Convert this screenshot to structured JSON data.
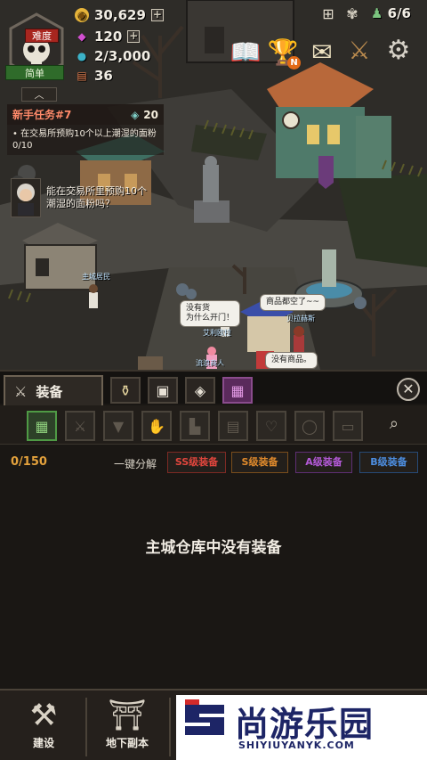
{
  "hud": {
    "difficulty_tag": "难度",
    "difficulty_level": "简单",
    "gold": "30,629",
    "gems": "120",
    "potion": "2/3,000",
    "cards": "36",
    "population": "6/6",
    "notify_badge": "N",
    "icons": [
      "gold-coin-icon",
      "gem-icon",
      "potion-icon",
      "card-icon",
      "gift-icon",
      "settings-icon"
    ]
  },
  "quest": {
    "title": "新手任务#7",
    "reward": "20",
    "line1": "在交易所预购10个以上潮湿的面粉",
    "progress": "0/10",
    "dialogue": "能在交易所里预购10个潮湿的面粉吗？"
  },
  "world_labels": {
    "bubble_left": "没有货\n为什么开门！",
    "bubble_mid": "商品都空了~~",
    "bubble_right": "没有商品。",
    "name_1": "主城居民",
    "name_2": "艾利欧拉",
    "name_3": "贝拉赫斯",
    "name_4": "流浪商人"
  },
  "panel": {
    "tab_label": "装备",
    "count": "0/150",
    "onekey_label": "一键分解",
    "grades": [
      {
        "label": "SS级装备",
        "color": "#e0463d"
      },
      {
        "label": "S级装备",
        "color": "#e08a2c"
      },
      {
        "label": "A级装备",
        "color": "#b45ad8"
      },
      {
        "label": "B级装备",
        "color": "#4d8ee0"
      }
    ],
    "empty_message": "主城仓库中没有装备"
  },
  "nav": {
    "items": [
      {
        "label": "建设",
        "icon": "hammer-icon"
      },
      {
        "label": "地下副本",
        "icon": "dungeon-gate-icon"
      }
    ]
  },
  "watermark": {
    "title": "尚游乐园",
    "url": "SHIYIUYANYK.COM"
  }
}
